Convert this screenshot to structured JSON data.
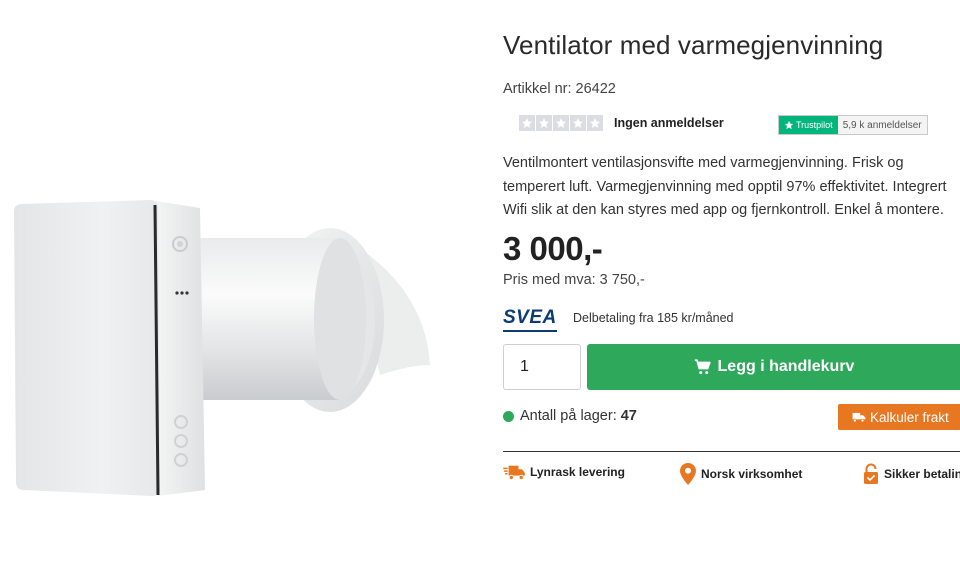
{
  "product": {
    "title": "Ventilator med varmegjenvinning",
    "article_number": "Artikkel nr: 26422",
    "rating": {
      "stars_filled": 0,
      "stars_total": 5,
      "reviews_label": "Ingen anmeldelser"
    },
    "trustpilot": {
      "label": "Trustpilot",
      "count": "5,9 k anmeldelser"
    },
    "description": "Ventilmontert ventilasjonsvifte med varmegjenvinning. Frisk og temperert luft. Varmegjenvinning med opptil 97% effektivitet. Integrert Wifi slik at den kan styres med app og fjernkontroll. Enkel å montere.",
    "price": "3 000,-",
    "price_vat": "Pris med mva: 3 750,-"
  },
  "financing": {
    "logo_text": "SVEA",
    "text": "Delbetaling fra 185 kr/måned"
  },
  "cart": {
    "quantity": "1",
    "button_label": "Legg i handlekurv"
  },
  "stock": {
    "label": "Antall på lager:",
    "value": "47"
  },
  "freight": {
    "button_label": "Kalkuler frakt"
  },
  "usps": [
    {
      "label": "Lynrask levering",
      "icon": "fast-truck-icon"
    },
    {
      "label": "Norsk virksomhet",
      "icon": "location-pin-icon"
    },
    {
      "label": "Sikker betalin",
      "icon": "lock-icon"
    }
  ],
  "colors": {
    "primary_green": "#2ea85a",
    "accent_orange": "#e87722",
    "trustpilot_green": "#00b67a",
    "svea_blue": "#0d3b73"
  }
}
